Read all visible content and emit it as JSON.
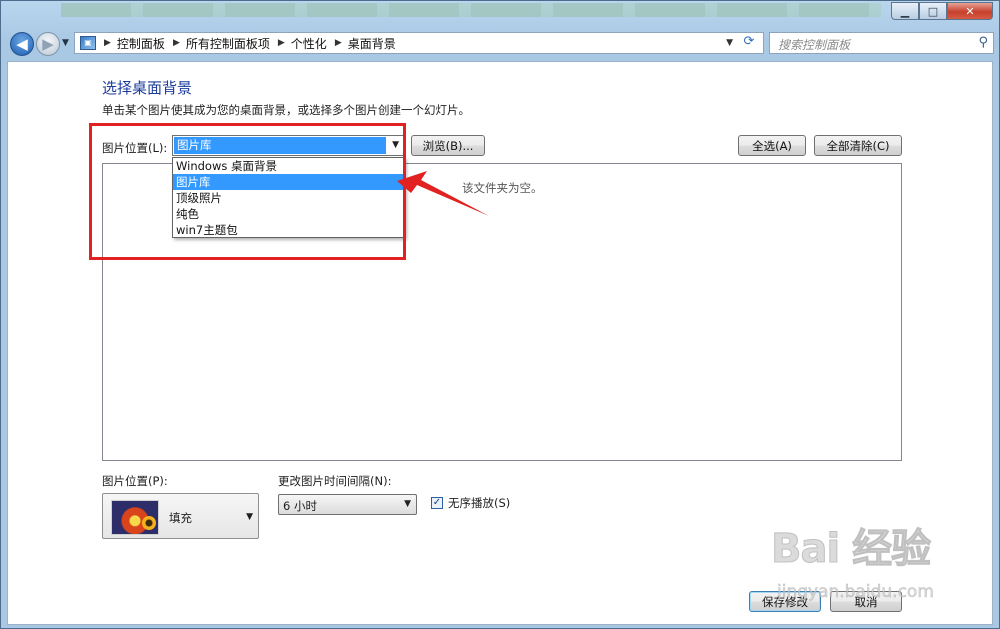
{
  "window": {
    "minimize": "▁",
    "maximize": "□",
    "close": "✕"
  },
  "navbar": {
    "breadcrumbs": [
      "控制面板",
      "所有控制面板项",
      "个性化",
      "桌面背景"
    ],
    "search_placeholder": "搜索控制面板",
    "icons": [
      "back-arrow",
      "forward-arrow",
      "refresh",
      "search"
    ]
  },
  "page": {
    "title": "选择桌面背景",
    "description": "单击某个图片使其成为您的桌面背景，或选择多个图片创建一个幻灯片。",
    "location_label": "图片位置(L):",
    "location_value": "图片库",
    "browse_label": "浏览(B)...",
    "select_all_label": "全选(A)",
    "clear_all_label": "全部清除(C)",
    "location_options": [
      "Windows 桌面背景",
      "图片库",
      "顶级照片",
      "纯色",
      "win7主题包"
    ],
    "selected_option_index": 1,
    "empty_message": "该文件夹为空。",
    "position_label": "图片位置(P):",
    "position_value": "填充",
    "interval_label": "更改图片时间间隔(N):",
    "interval_value": "6 小时",
    "shuffle_label": "无序播放(S)",
    "shuffle_checked": true,
    "save_label": "保存修改",
    "cancel_label": "取消"
  },
  "annotation": {
    "highlight_color": "#e22121"
  },
  "watermark": {
    "logo": "Bai 经验",
    "url": "jingyan.baidu.com"
  },
  "colors": {
    "title_blue": "#1e3d9b",
    "selection_blue": "#3399ff"
  }
}
